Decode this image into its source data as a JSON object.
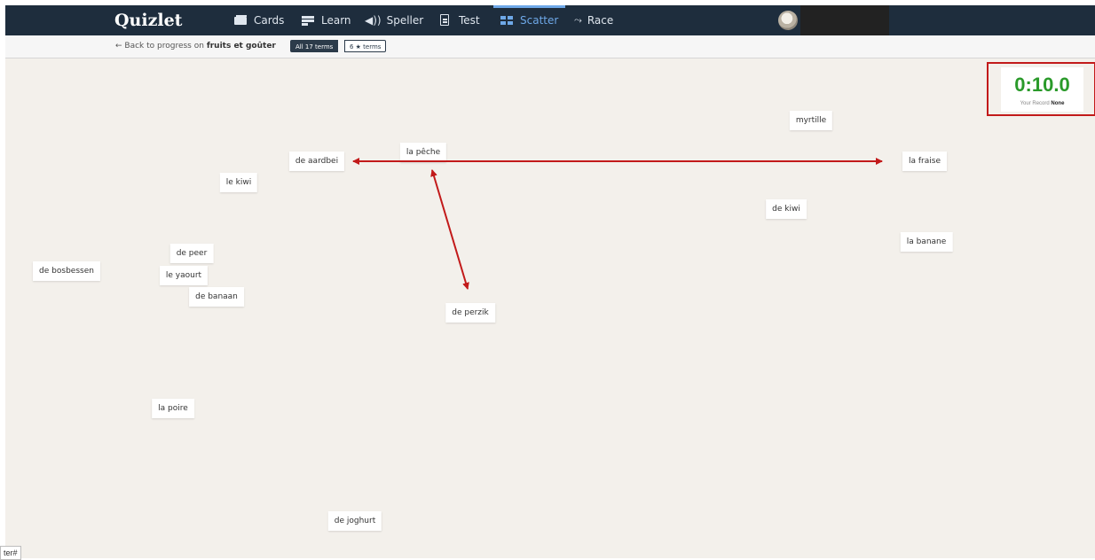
{
  "app": {
    "logo": "Quizlet"
  },
  "nav": {
    "items": [
      {
        "label": "Cards",
        "icon": "cards-icon"
      },
      {
        "label": "Learn",
        "icon": "learn-icon"
      },
      {
        "label": "Speller",
        "icon": "speaker-icon"
      },
      {
        "label": "Test",
        "icon": "test-icon"
      },
      {
        "label": "Scatter",
        "icon": "scatter-icon",
        "active": true
      },
      {
        "label": "Race",
        "icon": "race-icon"
      }
    ],
    "avatar": "avatar-icon"
  },
  "subbar": {
    "back_prefix": "← Back to progress on",
    "set_name": "fruits et goûter",
    "seg_all": "All 17 terms",
    "seg_star": "6 ★ terms"
  },
  "timer": {
    "value": "0:10.0",
    "record_label": "Your Record",
    "record_value": "None"
  },
  "tiles": [
    "myrtille",
    "la pêche",
    "de aardbei",
    "la fraise",
    "le kiwi",
    "de kiwi",
    "la banane",
    "de peer",
    "de bosbessen",
    "le yaourt",
    "de banaan",
    "de perzik",
    "la poire",
    "de joghurt"
  ],
  "corner_text": "ter#",
  "colors": {
    "nav_bg": "#1e2d3d",
    "active": "#6ea8e8",
    "stage_bg": "#f3f0eb",
    "timer": "#2a9a2a",
    "annotation": "#c21a1a"
  }
}
